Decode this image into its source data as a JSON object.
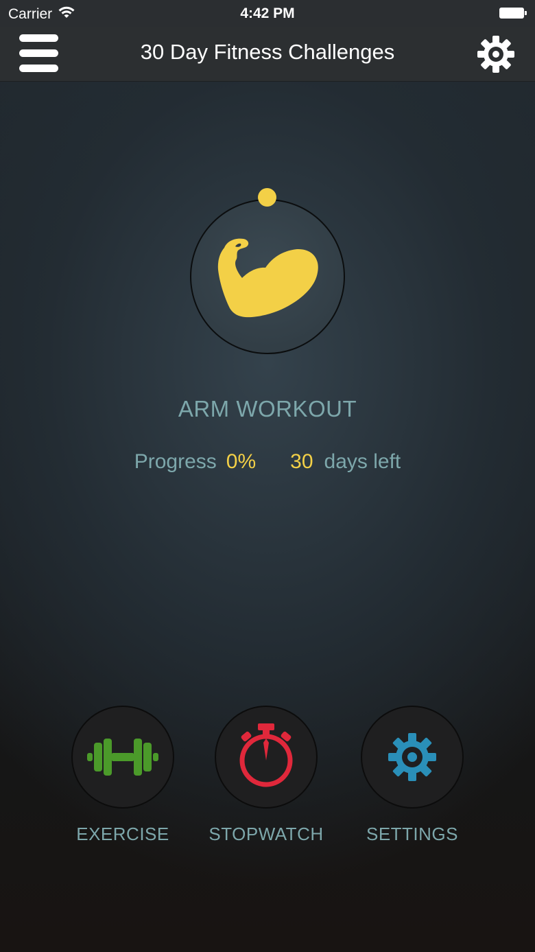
{
  "status_bar": {
    "carrier": "Carrier",
    "time": "4:42 PM",
    "wifi_icon": "wifi-icon",
    "battery_icon": "battery-icon"
  },
  "nav": {
    "title": "30 Day Fitness Challenges",
    "menu_icon": "hamburger-menu-icon",
    "settings_icon": "gear-icon"
  },
  "workout": {
    "icon": "flexed-bicep-icon",
    "title": "ARM WORKOUT",
    "progress_label": "Progress",
    "progress_value": "0%",
    "days_value": "30",
    "days_label": "days left",
    "progress_fraction": 0
  },
  "actions": [
    {
      "label": "EXERCISE",
      "icon": "dumbbell-icon",
      "color": "#4b9a2a"
    },
    {
      "label": "STOPWATCH",
      "icon": "stopwatch-icon",
      "color": "#e0283b"
    },
    {
      "label": "SETTINGS",
      "icon": "gear-icon",
      "color": "#2a8fb8"
    }
  ],
  "colors": {
    "accent_yellow": "#f3d047",
    "text_teal": "#7da7ab",
    "nav_background": "#2c2f31"
  }
}
